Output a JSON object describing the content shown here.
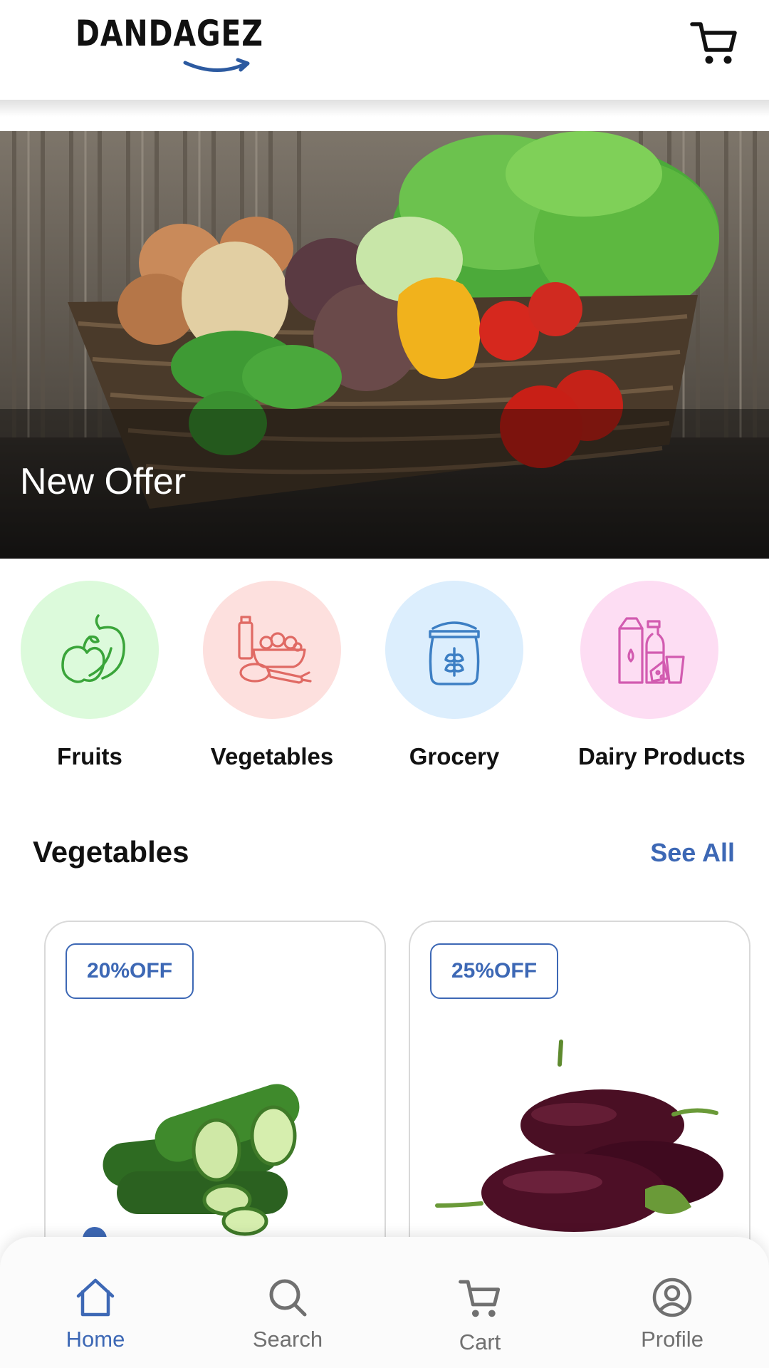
{
  "header": {
    "logo_text": "DANDAGEZ",
    "cart_icon": "cart-icon"
  },
  "banner": {
    "title": "New Offer"
  },
  "categories": [
    {
      "label": "Fruits",
      "icon": "fruits-icon",
      "bg": "#dcfadb",
      "color": "#3aa53a"
    },
    {
      "label": "Vegetables",
      "icon": "vegetables-icon",
      "bg": "#fde0de",
      "color": "#e06a64"
    },
    {
      "label": "Grocery",
      "icon": "grocery-icon",
      "bg": "#dceefd",
      "color": "#3d7fc4"
    },
    {
      "label": "Dairy Products",
      "icon": "dairy-icon",
      "bg": "#fdddf3",
      "color": "#d25bb0"
    }
  ],
  "section": {
    "title": "Vegetables",
    "see_all": "See All"
  },
  "products": [
    {
      "badge": "20%OFF",
      "image": "cucumber"
    },
    {
      "badge": "25%OFF",
      "image": "eggplant"
    }
  ],
  "nav": [
    {
      "label": "Home",
      "icon": "home-icon",
      "active": true
    },
    {
      "label": "Search",
      "icon": "search-icon",
      "active": false
    },
    {
      "label": "Cart",
      "icon": "cart-icon",
      "active": false
    },
    {
      "label": "Profile",
      "icon": "profile-icon",
      "active": false
    }
  ],
  "colors": {
    "accent": "#3d68b5",
    "text": "#111111",
    "inactive": "#707070"
  }
}
